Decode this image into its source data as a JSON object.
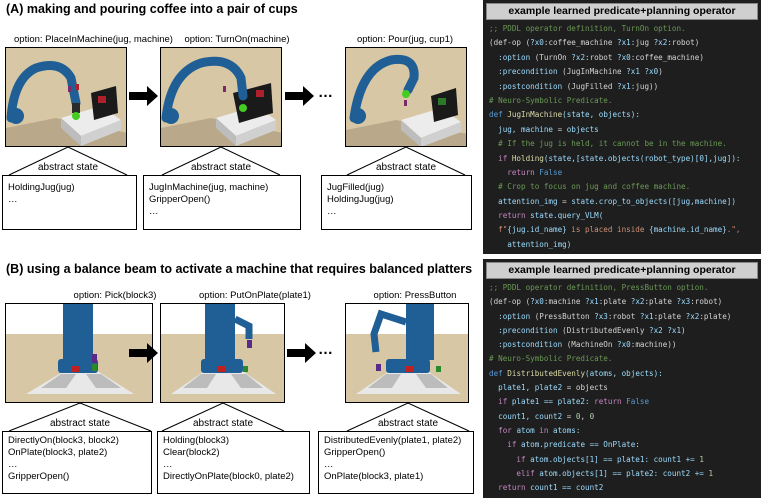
{
  "section_a": {
    "title": "(A) making and pouring coffee into a pair of cups",
    "options": [
      "option: PlaceInMachine(jug, machine)",
      "option: TurnOn(machine)",
      "option: Pour(jug, cup1)"
    ],
    "abstract_label": "abstract state",
    "states": [
      [
        "HoldingJug(jug)",
        "…"
      ],
      [
        "JugInMachine(jug, machine)",
        "GripperOpen()",
        "…"
      ],
      [
        "JugFilled(jug)",
        "HoldingJug(jug)",
        "…"
      ]
    ],
    "dots": "…"
  },
  "section_b": {
    "title": "(B) using a balance beam to activate a machine that requires balanced platters",
    "options": [
      "option: Pick(block3)",
      "option: PutOnPlate(plate1)",
      "option: PressButton"
    ],
    "abstract_label": "abstract state",
    "states": [
      [
        "DirectlyOn(block3, block2)",
        "OnPlate(block3, plate2)",
        "…",
        "GripperOpen()"
      ],
      [
        "Holding(block3)",
        "Clear(block2)",
        "…",
        "DirectlyOnPlate(block0, plate2)"
      ],
      [
        "DistributedEvenly(plate1, plate2)",
        "GripperOpen()",
        "…",
        "OnPlate(block3, plate1)"
      ]
    ],
    "dots": "…"
  },
  "code_a": {
    "header": "example learned predicate+planning operator",
    "lines": [
      [
        {
          "t": ";; PDDL operator definition, TurnOn option.",
          "c": "cm"
        }
      ],
      [
        {
          "t": "(def-op (",
          "c": ""
        },
        {
          "t": "?x0",
          "c": "vr"
        },
        {
          "t": ":coffee_machine ",
          "c": ""
        },
        {
          "t": "?x1",
          "c": "vr"
        },
        {
          "t": ":jug ",
          "c": ""
        },
        {
          "t": "?x2",
          "c": "vr"
        },
        {
          "t": ":robot)",
          "c": ""
        }
      ],
      [
        {
          "t": "  :option ",
          "c": "vr"
        },
        {
          "t": "(TurnOn ",
          "c": ""
        },
        {
          "t": "?x2",
          "c": "vr"
        },
        {
          "t": ":robot ",
          "c": ""
        },
        {
          "t": "?x0",
          "c": "vr"
        },
        {
          "t": ":coffee_machine)",
          "c": ""
        }
      ],
      [
        {
          "t": "  :precondition ",
          "c": "vr"
        },
        {
          "t": "(JugInMachine ",
          "c": ""
        },
        {
          "t": "?x1 ?x0",
          "c": "vr"
        },
        {
          "t": ")",
          "c": ""
        }
      ],
      [
        {
          "t": "  :postcondition ",
          "c": "vr"
        },
        {
          "t": "(JugFilled ",
          "c": ""
        },
        {
          "t": "?x1",
          "c": "vr"
        },
        {
          "t": ":jug))",
          "c": ""
        }
      ],
      [
        {
          "t": "# Neuro-Symbolic Predicate.",
          "c": "cm"
        }
      ],
      [
        {
          "t": "def ",
          "c": "kb"
        },
        {
          "t": "JugInMachine",
          "c": "fn"
        },
        {
          "t": "(state, objects):",
          "c": "vr"
        }
      ],
      [
        {
          "t": "  jug, machine ",
          "c": "vr"
        },
        {
          "t": "= ",
          "c": ""
        },
        {
          "t": "objects",
          "c": "vr"
        }
      ],
      [
        {
          "t": "  # If the jug is held, it cannot be in the machine.",
          "c": "cm"
        }
      ],
      [
        {
          "t": "  if ",
          "c": "kw"
        },
        {
          "t": "Holding",
          "c": "fn"
        },
        {
          "t": "(state,[state.objects(robot_type)[0],jug]):",
          "c": "vr"
        }
      ],
      [
        {
          "t": "    return ",
          "c": "kw"
        },
        {
          "t": "False",
          "c": "kb"
        }
      ],
      [
        {
          "t": "  # Crop to focus on jug and coffee machine.",
          "c": "cm"
        }
      ],
      [
        {
          "t": "  attention_img ",
          "c": "vr"
        },
        {
          "t": "= ",
          "c": ""
        },
        {
          "t": "state.crop_to_objects([jug,machine])",
          "c": "vr"
        }
      ],
      [
        {
          "t": "  return ",
          "c": "kw"
        },
        {
          "t": "state.query_VLM(",
          "c": "vr"
        }
      ],
      [
        {
          "t": "  f\"",
          "c": "st"
        },
        {
          "t": "{jug.id_name}",
          "c": "vr"
        },
        {
          "t": " is placed inside ",
          "c": "st"
        },
        {
          "t": "{machine.id_name}",
          "c": "vr"
        },
        {
          "t": ".\",",
          "c": "st"
        }
      ],
      [
        {
          "t": "    attention_img)",
          "c": "vr"
        }
      ]
    ]
  },
  "code_b": {
    "header": "example learned predicate+planning operator",
    "lines": [
      [
        {
          "t": ";; PDDL operator definition, PressButton option.",
          "c": "cm"
        }
      ],
      [
        {
          "t": "(def-op (",
          "c": ""
        },
        {
          "t": "?x0",
          "c": "vr"
        },
        {
          "t": ":machine ",
          "c": ""
        },
        {
          "t": "?x1",
          "c": "vr"
        },
        {
          "t": ":plate ",
          "c": ""
        },
        {
          "t": "?x2",
          "c": "vr"
        },
        {
          "t": ":plate ",
          "c": ""
        },
        {
          "t": "?x3",
          "c": "vr"
        },
        {
          "t": ":robot)",
          "c": ""
        }
      ],
      [
        {
          "t": "  :option ",
          "c": "vr"
        },
        {
          "t": "(PressButton ",
          "c": ""
        },
        {
          "t": "?x3",
          "c": "vr"
        },
        {
          "t": ":robot ",
          "c": ""
        },
        {
          "t": "?x1",
          "c": "vr"
        },
        {
          "t": ":plate ",
          "c": ""
        },
        {
          "t": "?x2",
          "c": "vr"
        },
        {
          "t": ":plate)",
          "c": ""
        }
      ],
      [
        {
          "t": "  :precondition ",
          "c": "vr"
        },
        {
          "t": "(DistributedEvenly ",
          "c": ""
        },
        {
          "t": "?x2 ?x1",
          "c": "vr"
        },
        {
          "t": ")",
          "c": ""
        }
      ],
      [
        {
          "t": "  :postcondition ",
          "c": "vr"
        },
        {
          "t": "(MachineOn ",
          "c": ""
        },
        {
          "t": "?x0",
          "c": "vr"
        },
        {
          "t": ":machine))",
          "c": ""
        }
      ],
      [
        {
          "t": "# Neuro-Symbolic Predicate.",
          "c": "cm"
        }
      ],
      [
        {
          "t": "def ",
          "c": "kb"
        },
        {
          "t": "DistributedEvenly",
          "c": "fn"
        },
        {
          "t": "(atoms, objects):",
          "c": "vr"
        }
      ],
      [
        {
          "t": "  plate1, plate2 ",
          "c": "vr"
        },
        {
          "t": "= objects",
          "c": ""
        }
      ],
      [
        {
          "t": "  if ",
          "c": "kw"
        },
        {
          "t": "plate1 == plate2: ",
          "c": "vr"
        },
        {
          "t": "return ",
          "c": "kw"
        },
        {
          "t": "False",
          "c": "kb"
        }
      ],
      [
        {
          "t": "  count1, count2 ",
          "c": "vr"
        },
        {
          "t": "= ",
          "c": ""
        },
        {
          "t": "0",
          "c": "nm"
        },
        {
          "t": ", ",
          "c": ""
        },
        {
          "t": "0",
          "c": "nm"
        }
      ],
      [
        {
          "t": "  for ",
          "c": "kw"
        },
        {
          "t": "atom ",
          "c": "vr"
        },
        {
          "t": "in ",
          "c": "kw"
        },
        {
          "t": "atoms:",
          "c": "vr"
        }
      ],
      [
        {
          "t": "    if ",
          "c": "kw"
        },
        {
          "t": "atom.predicate == OnPlate:",
          "c": "vr"
        }
      ],
      [
        {
          "t": "      if ",
          "c": "kw"
        },
        {
          "t": "atom.objects[1] == plate1: count1 += ",
          "c": "vr"
        },
        {
          "t": "1",
          "c": "nm"
        }
      ],
      [
        {
          "t": "      elif ",
          "c": "kw"
        },
        {
          "t": "atom.objects[1] == plate2: count2 += ",
          "c": "vr"
        },
        {
          "t": "1",
          "c": "nm"
        }
      ],
      [
        {
          "t": "  return ",
          "c": "kw"
        },
        {
          "t": "count1 == count2",
          "c": "vr"
        }
      ]
    ]
  },
  "colors": {
    "robot_blue": "#1f5f96",
    "tan_bg": "#d9c9a8",
    "code_bg": "#1e1e1e"
  }
}
